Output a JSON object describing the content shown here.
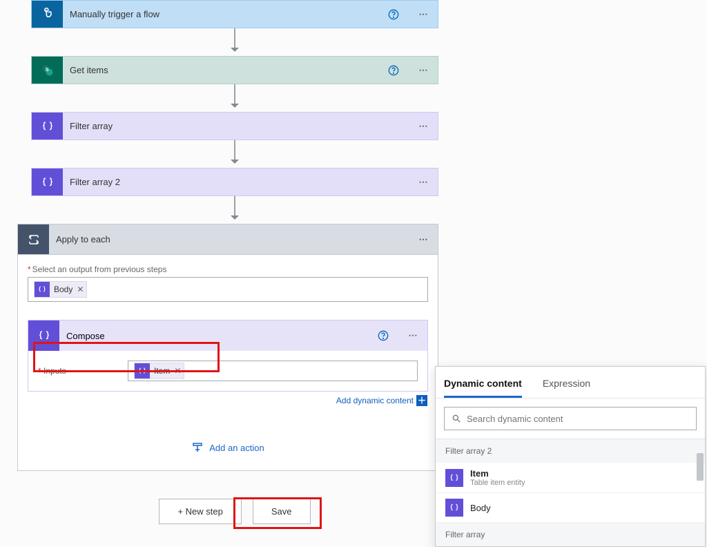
{
  "steps": {
    "trigger": {
      "label": "Manually trigger a flow"
    },
    "getitems": {
      "label": "Get items"
    },
    "filter1": {
      "label": "Filter array"
    },
    "filter2": {
      "label": "Filter array 2"
    }
  },
  "apply": {
    "title": "Apply to each",
    "select_label": "Select an output from previous steps",
    "body_token": "Body"
  },
  "compose": {
    "title": "Compose",
    "inputs_label": "Inputs",
    "item_token": "Item",
    "add_dyn": "Add dynamic content"
  },
  "add_action": "Add an action",
  "footer": {
    "newstep": "+ New step",
    "save": "Save"
  },
  "popup": {
    "tab_dynamic": "Dynamic content",
    "tab_expr": "Expression",
    "search_placeholder": "Search dynamic content",
    "section1": "Filter array 2",
    "item1": {
      "name": "Item",
      "sub": "Table item entity"
    },
    "item2": {
      "name": "Body"
    },
    "section2": "Filter array"
  }
}
